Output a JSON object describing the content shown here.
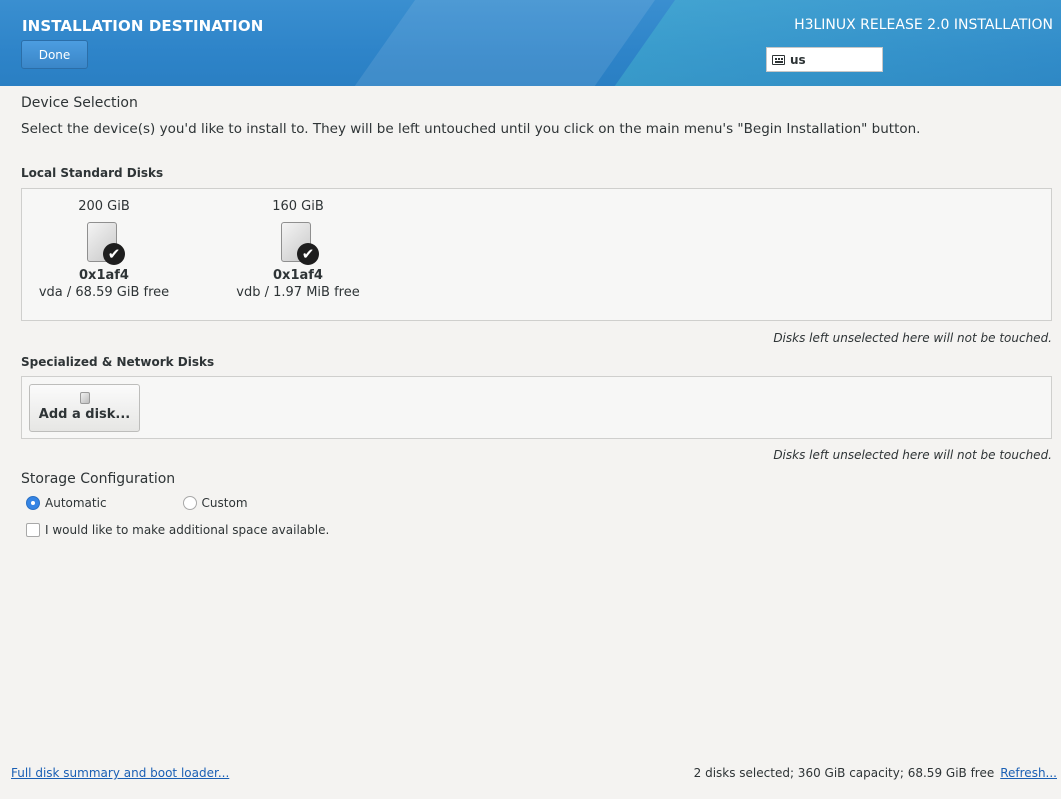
{
  "header": {
    "title": "INSTALLATION DESTINATION",
    "done_label": "Done",
    "product": "H3LINUX RELEASE 2.0 INSTALLATION",
    "keyboard_layout": "us"
  },
  "device_selection": {
    "title": "Device Selection",
    "description": "Select the device(s) you'd like to install to.  They will be left untouched until you click on the main menu's \"Begin Installation\" button."
  },
  "local_disks": {
    "heading": "Local Standard Disks",
    "disks": [
      {
        "capacity": "200 GiB",
        "name": "0x1af4",
        "detail": "vda  /  68.59 GiB free",
        "selected": true
      },
      {
        "capacity": "160 GiB",
        "name": "0x1af4",
        "detail": "vdb  /  1.97 MiB free",
        "selected": true
      }
    ],
    "note": "Disks left unselected here will not be touched."
  },
  "network_disks": {
    "heading": "Specialized & Network Disks",
    "add_label": "Add a disk...",
    "note": "Disks left unselected here will not be touched."
  },
  "storage": {
    "title": "Storage Configuration",
    "automatic_label": "Automatic",
    "custom_label": "Custom",
    "selected": "Automatic",
    "space_label": "I would like to make additional space available."
  },
  "footer": {
    "summary_link": "Full disk summary and boot loader...",
    "status": "2 disks selected; 360 GiB capacity; 68.59 GiB free",
    "refresh_label": "Refresh..."
  },
  "colors": {
    "header_blue": "#2e84c9",
    "accent": "#3584e4",
    "link": "#1a5fb4"
  }
}
